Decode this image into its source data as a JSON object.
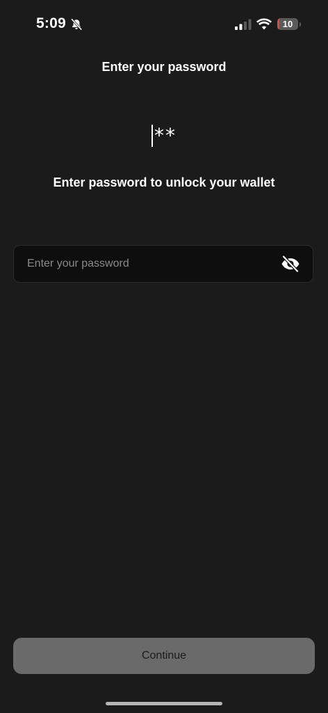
{
  "status_bar": {
    "time": "5:09",
    "battery_text": "10",
    "battery_level": 0.1,
    "icons": [
      "bell-slash-icon",
      "cellular-signal-icon",
      "wifi-icon",
      "battery-icon"
    ]
  },
  "page": {
    "title": "Enter your password",
    "password_mask": "**",
    "instruction": "Enter password to unlock your wallet"
  },
  "password_field": {
    "value": "",
    "placeholder": "Enter your password",
    "visibility_icon": "eye-slash-icon"
  },
  "actions": {
    "continue_label": "Continue"
  },
  "colors": {
    "background": "#1b1b1b",
    "field_background": "#0e0e0e",
    "button_background": "#6a6a6a",
    "battery_low": "#e5453c"
  }
}
